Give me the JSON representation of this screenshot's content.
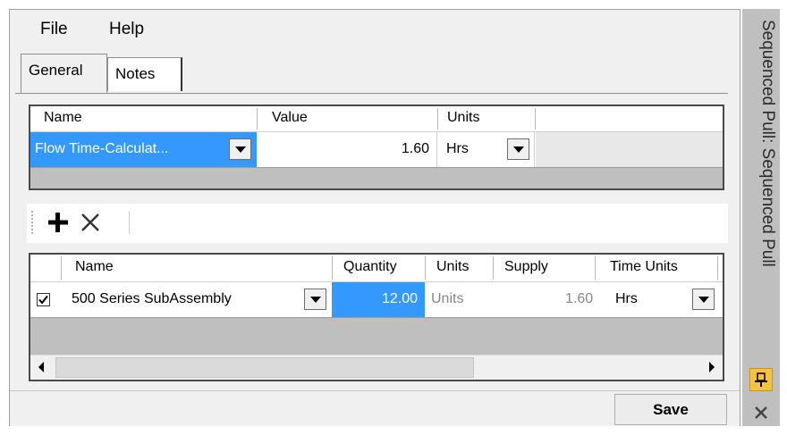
{
  "menu": {
    "file": "File",
    "help": "Help"
  },
  "tabs": {
    "general": "General",
    "notes": "Notes"
  },
  "properties": {
    "headers": {
      "name": "Name",
      "value": "Value",
      "units": "Units"
    },
    "row": {
      "name": "Flow Time-Calculat...",
      "value": "1.60",
      "units": "Hrs"
    }
  },
  "toolbar": {
    "add_icon": "plus-icon",
    "remove_icon": "close-icon"
  },
  "items": {
    "headers": {
      "name": "Name",
      "quantity": "Quantity",
      "units": "Units",
      "supply": "Supply",
      "time_units": "Time Units"
    },
    "row": {
      "checked": true,
      "name": "500 Series SubAssembly",
      "quantity": "12.00",
      "units": "Units",
      "supply": "1.60",
      "time_units": "Hrs"
    }
  },
  "buttons": {
    "save": "Save"
  },
  "side_panel": {
    "title": "Sequenced Pull: Sequenced Pull",
    "pin_icon": "pin-icon",
    "close_icon": "close-icon"
  },
  "colors": {
    "selection": "#3399ff",
    "frame": "#f0f0f0",
    "panel": "#bfbfbf",
    "pin": "#f5c242"
  }
}
